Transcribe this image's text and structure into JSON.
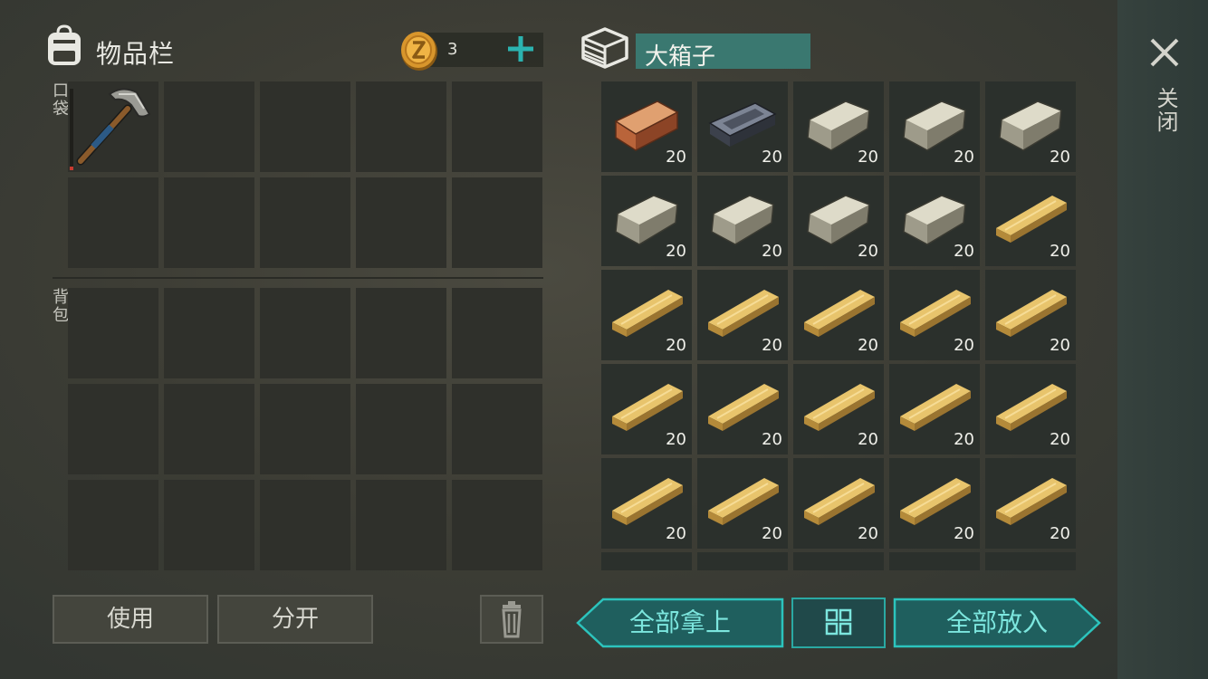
{
  "inventory": {
    "title": "物品栏",
    "icon": "backpack-icon",
    "pocket_label": "口袋",
    "bag_label": "背包",
    "coins": {
      "count": "3",
      "icon": "coin-icon",
      "plus_icon": "plus-icon"
    },
    "pocket_slots": [
      {
        "item": "pickaxe",
        "durability_fraction": 0.04
      },
      {},
      {},
      {},
      {},
      {},
      {},
      {},
      {},
      {}
    ],
    "bag_slots": [
      {},
      {},
      {},
      {},
      {},
      {},
      {},
      {},
      {},
      {},
      {},
      {},
      {},
      {},
      {}
    ],
    "buttons": {
      "use": "使用",
      "split": "分开",
      "trash_icon": "trash-icon"
    }
  },
  "container": {
    "name": "大箱子",
    "icon": "crate-icon",
    "slots": [
      {
        "item": "log",
        "qty": "20"
      },
      {
        "item": "iron-ingot",
        "qty": "20"
      },
      {
        "item": "stone",
        "qty": "20"
      },
      {
        "item": "stone",
        "qty": "20"
      },
      {
        "item": "stone",
        "qty": "20"
      },
      {
        "item": "stone",
        "qty": "20"
      },
      {
        "item": "stone",
        "qty": "20"
      },
      {
        "item": "stone",
        "qty": "20"
      },
      {
        "item": "stone",
        "qty": "20"
      },
      {
        "item": "plank",
        "qty": "20"
      },
      {
        "item": "plank",
        "qty": "20"
      },
      {
        "item": "plank",
        "qty": "20"
      },
      {
        "item": "plank",
        "qty": "20"
      },
      {
        "item": "plank",
        "qty": "20"
      },
      {
        "item": "plank",
        "qty": "20"
      },
      {
        "item": "plank",
        "qty": "20"
      },
      {
        "item": "plank",
        "qty": "20"
      },
      {
        "item": "plank",
        "qty": "20"
      },
      {
        "item": "plank",
        "qty": "20"
      },
      {
        "item": "plank",
        "qty": "20"
      },
      {
        "item": "plank",
        "qty": "20"
      },
      {
        "item": "plank",
        "qty": "20"
      },
      {
        "item": "plank",
        "qty": "20"
      },
      {
        "item": "plank",
        "qty": "20"
      },
      {
        "item": "plank",
        "qty": "20"
      }
    ],
    "buttons": {
      "take_all": "全部拿上",
      "put_all": "全部放入",
      "sort_icon": "sort-grid-icon"
    }
  },
  "close": {
    "label": "关闭",
    "icon": "close-icon"
  },
  "colors": {
    "accent": "#2bb3b0",
    "slot": "#2f302b",
    "container_name_bg": "#3a7870"
  }
}
